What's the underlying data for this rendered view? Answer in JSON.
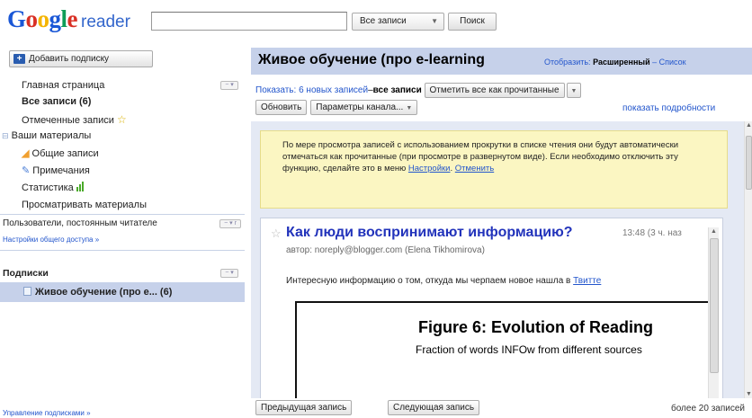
{
  "logo": {
    "google": "Google",
    "product": "reader"
  },
  "search": {
    "value": "",
    "scope": "Все записи",
    "button": "Поиск"
  },
  "nav": {
    "add_subscription": "Добавить подписку",
    "home": "Главная страница",
    "all_items": "Все записи (6)",
    "starred": "Отмеченные записи",
    "your_stuff": "Ваши материалы",
    "shared": "Общие записи",
    "notes": "Примечания",
    "trends": "Статистика",
    "browse": "Просматривать материалы",
    "people": "Пользователи, постоянным читателе",
    "sharing_settings": "Настройки общего доступа »",
    "subscriptions": "Подписки",
    "feed_item": "Живое обучение (про e... (6)",
    "manage": "Управление подписками »"
  },
  "main": {
    "title": "Живое обучение (про e-learning",
    "display_label": "Отобразить:",
    "display_expanded": "Расширенный",
    "display_sep": " – ",
    "display_list": "Список",
    "show_label": "Показать:",
    "show_new": "6 новых записей",
    "show_sep": "– ",
    "show_all": "все записи",
    "mark_all_read": "Отметить все как прочитанные",
    "refresh": "Обновить",
    "feed_settings": "Параметры канала...",
    "show_details": "показать подробности"
  },
  "notice": {
    "text": "По мере просмотра записей с использованием прокрутки в списке чтения они будут автоматически отмечаться как прочитанные (при просмотре в развернутом виде). Если необходимо отключить эту функцию, сделайте это в меню",
    "settings_link": "Настройки",
    "undo_link": "Отменить"
  },
  "entry": {
    "title": "Как люди воспринимают информацию?",
    "time": "13:48 (3 ч. наз",
    "author": "автор: noreply@blogger.com (Elena Tikhomirova)",
    "text": "Интересную информацию о том, откуда мы черпаем новое нашла в",
    "link": "Твитте",
    "figure_title": "Figure 6:  Evolution of Reading",
    "figure_sub": "Fraction of words INFOw from different sources"
  },
  "footer": {
    "prev": "Предыдущая запись",
    "next": "Следующая запись",
    "count": "более 20 записей"
  }
}
